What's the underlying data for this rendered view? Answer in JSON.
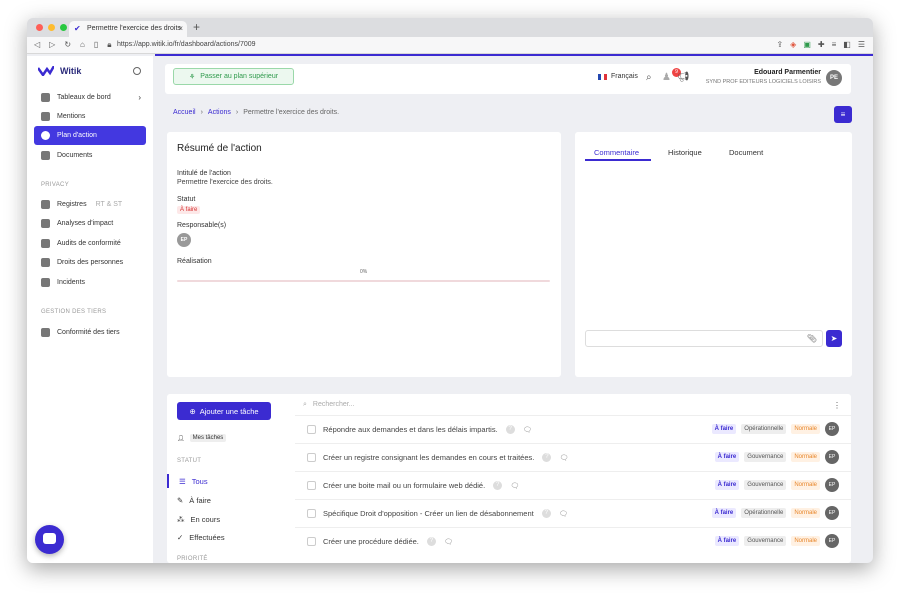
{
  "browser": {
    "tab_title": "Permettre l'exercice des droits",
    "tab_close": "×",
    "new_tab": "+",
    "url": "https://app.witik.io/fr/dashboard/actions/7009"
  },
  "sidebar": {
    "brand": "Witik",
    "items": [
      {
        "label": "Tableaux de bord",
        "icon": "dashboard-icon",
        "chevron": "›"
      },
      {
        "label": "Mentions",
        "icon": "mentions-icon"
      },
      {
        "label": "Plan d'action",
        "icon": "target-icon",
        "active": true
      },
      {
        "label": "Documents",
        "icon": "folder-icon"
      }
    ],
    "privacy_section": "PRIVACY",
    "privacy_items": [
      {
        "label": "Registres",
        "suffix": "RT & ST",
        "icon": "books-icon"
      },
      {
        "label": "Analyses d'impact",
        "icon": "shield-icon"
      },
      {
        "label": "Audits de conformité",
        "icon": "audit-icon"
      },
      {
        "label": "Droits des personnes",
        "icon": "people-icon"
      },
      {
        "label": "Incidents",
        "icon": "fire-icon"
      }
    ],
    "third_party_section": "GESTION DES TIERS",
    "third_party_items": [
      {
        "label": "Conformité des tiers",
        "icon": "network-icon"
      }
    ]
  },
  "topbar": {
    "upgrade_label": "Passer au plan supérieur",
    "language": "Français",
    "notification_count": "9",
    "user_name": "Edouard Parmentier",
    "user_org": "SYND PROF EDITEURS LOGICIELS LOISIRS",
    "user_initials": "PE"
  },
  "breadcrumb": {
    "home": "Accueil",
    "sep": "›",
    "actions": "Actions",
    "current": "Permettre l'exercice des droits."
  },
  "summary": {
    "title": "Résumé de l'action",
    "intitule_label": "Intitulé de l'action",
    "intitule_value": "Permettre l'exercice des droits.",
    "statut_label": "Statut",
    "statut_value": "À faire",
    "responsables_label": "Responsable(s)",
    "responsable_initials": "EP",
    "realisation_label": "Réalisation",
    "realisation_pct": "0%",
    "realisation_progress": 0
  },
  "comments": {
    "tabs": [
      "Commentaire",
      "Historique",
      "Document"
    ]
  },
  "tasks": {
    "add_label": "Ajouter une tâche",
    "my_tasks_label": "Mes tâches",
    "statut_section": "STATUT",
    "filters": [
      "Tous",
      "À faire",
      "En cours",
      "Effectuées"
    ],
    "priority_section": "PRIORITÉ",
    "search_placeholder": "Rechercher...",
    "rows": [
      {
        "text": "Répondre aux demandes et dans les délais impartis.",
        "status": "À faire",
        "type": "Opérationnelle",
        "priority": "Normale",
        "assignee": "EP"
      },
      {
        "text": "Créer un registre consignant les demandes en cours et traitées.",
        "status": "À faire",
        "type": "Gouvernance",
        "priority": "Normale",
        "assignee": "EP"
      },
      {
        "text": "Créer une boite mail ou un formulaire web dédié.",
        "status": "À faire",
        "type": "Gouvernance",
        "priority": "Normale",
        "assignee": "EP"
      },
      {
        "text": "Spécifique Droit d'opposition - Créer un lien de désabonnement",
        "status": "À faire",
        "type": "Opérationnelle",
        "priority": "Normale",
        "assignee": "EP"
      },
      {
        "text": "Créer une procédure dédiée.",
        "status": "À faire",
        "type": "Gouvernance",
        "priority": "Normale",
        "assignee": "EP"
      }
    ]
  },
  "colors": {
    "accent": "#3b2bd1",
    "danger": "#d63030",
    "warning": "#e8862a",
    "success": "#2f9a4c"
  }
}
